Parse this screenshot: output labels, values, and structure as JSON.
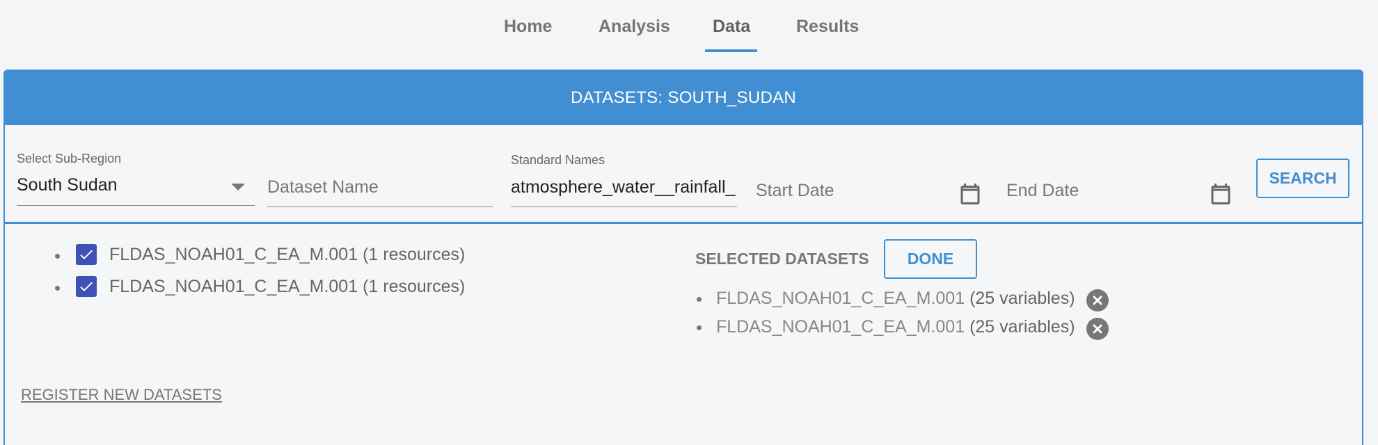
{
  "nav": {
    "tabs": [
      {
        "label": "Home"
      },
      {
        "label": "Analysis"
      },
      {
        "label": "Data"
      },
      {
        "label": "Results"
      }
    ],
    "active_tab": "Data"
  },
  "panel": {
    "title": "DATASETS: SOUTH_SUDAN"
  },
  "search": {
    "subregion_label": "Select Sub-Region",
    "subregion_value": "South Sudan",
    "dataset_name_placeholder": "Dataset Name",
    "standard_names_label": "Standard Names",
    "standard_names_value": "atmosphere_water__rainfall_",
    "start_date_placeholder": "Start Date",
    "end_date_placeholder": "End Date",
    "search_button": "SEARCH"
  },
  "results": {
    "items": [
      {
        "label": "FLDAS_NOAH01_C_EA_M.001 (1 resources)",
        "checked": true
      },
      {
        "label": "FLDAS_NOAH01_C_EA_M.001 (1 resources)",
        "checked": true
      }
    ]
  },
  "selected": {
    "title": "SELECTED DATASETS",
    "done_button": "DONE",
    "items": [
      {
        "name": "FLDAS_NOAH01_C_EA_M.001",
        "count": "(25 variables)"
      },
      {
        "name": "FLDAS_NOAH01_C_EA_M.001",
        "count": "(25 variables)"
      }
    ]
  },
  "register_link": "REGISTER NEW DATASETS",
  "colors": {
    "accent": "#418fd2",
    "checkbox": "#3f51b5"
  }
}
